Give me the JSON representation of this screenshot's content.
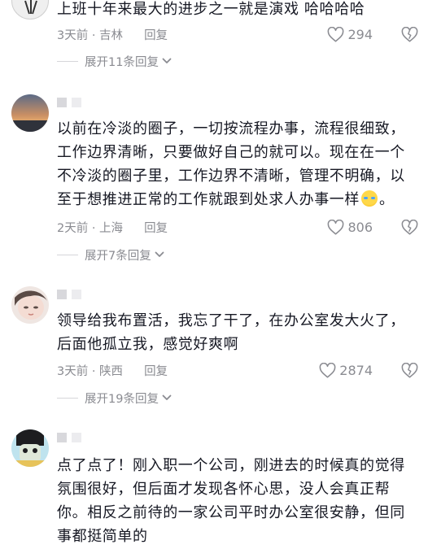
{
  "comments": [
    {
      "text": "上班十年来最大的进步之一就是演戏 哈哈哈哈",
      "meta": "3天前 · 吉林",
      "reply_label": "回复",
      "likes": "294",
      "expand_label": "展开11条回复"
    },
    {
      "text_before_emoji": "以前在冷淡的圈子，一切按流程办事，流程很细致，工作边界清晰，只要做好自己的就可以。现在在一个不冷淡的圈子里，工作边界不清晰，管理不明确，以至于想推进正常的工作就跟到处求人办事一样",
      "text_after_emoji": "。",
      "emoji": "crying-laughing-emoji",
      "meta": "2天前 · 上海",
      "reply_label": "回复",
      "likes": "806",
      "expand_label": "展开7条回复"
    },
    {
      "text": "领导给我布置活，我忘了干了，在办公室发大火了，后面他孤立我，感觉好爽啊",
      "meta": "3天前 · 陕西",
      "reply_label": "回复",
      "likes": "2874",
      "expand_label": "展开19条回复"
    },
    {
      "text": "点了点了！刚入职一个公司，刚进去的时候真的觉得氛围很好，但后面才发现各怀心思，没人会真正帮你。相反之前待的一家公司平时办公室很安静，但同事都挺简单的"
    }
  ],
  "icons": {
    "like": "heart-outline-icon",
    "dislike": "broken-heart-outline-icon",
    "expand": "chevron-down-icon"
  },
  "colors": {
    "text": "#161823",
    "meta": "#8a8b91",
    "background": "#ffffff"
  }
}
